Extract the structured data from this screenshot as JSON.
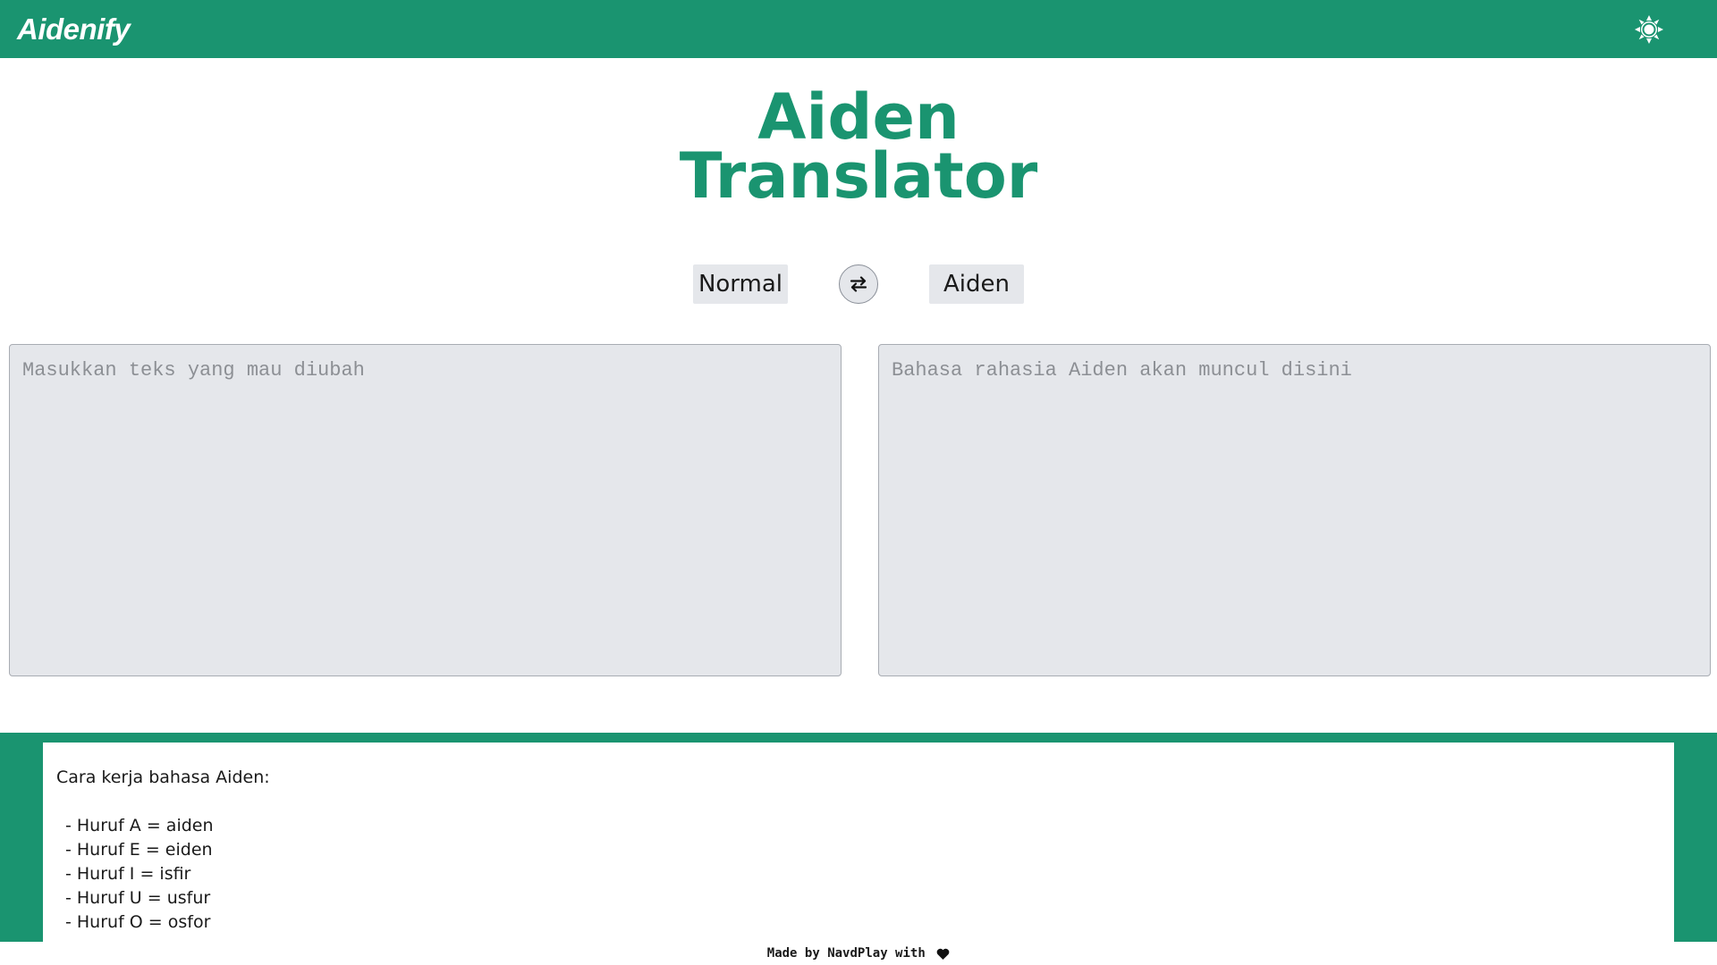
{
  "navbar": {
    "brand": "Aidenify",
    "theme_toggle_icon": "sun-icon"
  },
  "title": {
    "line1": "Aiden",
    "line2": "Translator"
  },
  "switcher": {
    "source_language": "Normal",
    "target_language": "Aiden",
    "swap_icon": "swap-arrows-icon"
  },
  "input": {
    "placeholder": "Masukkan teks yang mau diubah",
    "value": ""
  },
  "output": {
    "placeholder": "Bahasa rahasia Aiden akan muncul disini",
    "value": ""
  },
  "info": {
    "heading": "Cara kerja bahasa Aiden:",
    "rules": [
      "- Huruf A = aiden",
      "- Huruf E = eiden",
      "- Huruf I = isfir",
      "- Huruf U = usfur",
      "- Huruf O = osfor"
    ]
  },
  "footer": {
    "text": "Made by NavdPlay with",
    "icon": "heart-icon"
  },
  "colors": {
    "accent": "#1a9470",
    "field_bg": "#e5e7eb",
    "placeholder": "#8c8f94"
  }
}
